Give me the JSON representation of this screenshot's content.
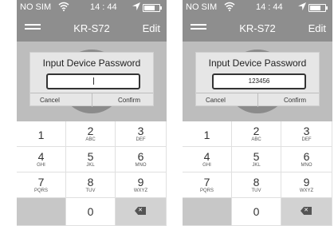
{
  "screens": [
    {
      "status_bar": {
        "carrier": "NO SIM",
        "time": "14 : 44"
      },
      "nav": {
        "title": "KR-S72",
        "edit": "Edit"
      },
      "dialog": {
        "title": "Input Device Password",
        "password_value": "",
        "cancel": "Cancel",
        "confirm": "Confirm"
      }
    },
    {
      "status_bar": {
        "carrier": "NO SIM",
        "time": "14 : 44"
      },
      "nav": {
        "title": "KR-S72",
        "edit": "Edit"
      },
      "dialog": {
        "title": "Input Device Password",
        "password_value": "123456",
        "cancel": "Cancel",
        "confirm": "Confirm"
      }
    }
  ],
  "keypad": [
    {
      "num": "1",
      "letters": ""
    },
    {
      "num": "2",
      "letters": "ABC"
    },
    {
      "num": "3",
      "letters": "DEF"
    },
    {
      "num": "4",
      "letters": "GHI"
    },
    {
      "num": "5",
      "letters": "JKL"
    },
    {
      "num": "6",
      "letters": "MNO"
    },
    {
      "num": "7",
      "letters": "PQRS"
    },
    {
      "num": "8",
      "letters": "TUV"
    },
    {
      "num": "9",
      "letters": "WXYZ"
    },
    {
      "num": "0",
      "letters": ""
    }
  ],
  "icons": {
    "wifi": "wifi-icon",
    "location": "location-arrow-icon",
    "battery": "battery-icon",
    "menu": "hamburger-menu-icon",
    "backspace": "backspace-icon"
  },
  "colors": {
    "bar_gray": "#8e8e8e",
    "screen_gray": "#bdbdbd",
    "dialog": "#e6e6e6"
  }
}
